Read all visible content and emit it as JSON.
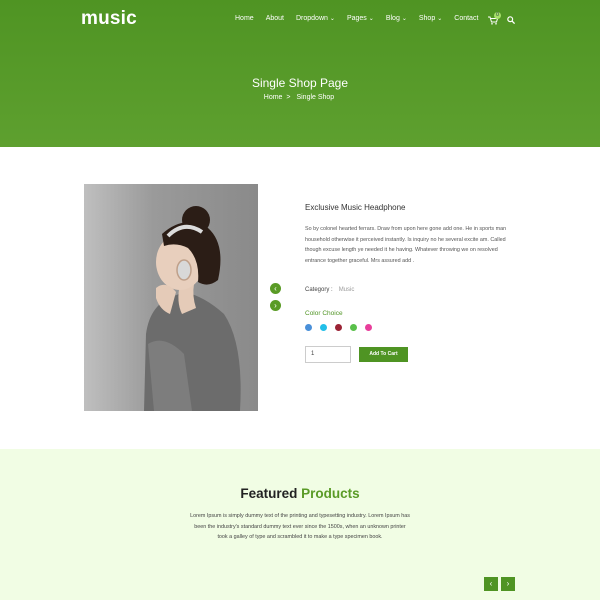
{
  "header": {
    "logo": "music",
    "nav": [
      {
        "label": "Home",
        "dropdown": false
      },
      {
        "label": "About",
        "dropdown": false
      },
      {
        "label": "Dropdown",
        "dropdown": true
      },
      {
        "label": "Pages",
        "dropdown": true
      },
      {
        "label": "Blog",
        "dropdown": true
      },
      {
        "label": "Shop",
        "dropdown": true
      },
      {
        "label": "Contact",
        "dropdown": false
      }
    ],
    "cart_count": "0"
  },
  "hero": {
    "title": "Single Shop Page",
    "breadcrumb": {
      "home": "Home",
      "separator": ">",
      "current": "Single Shop"
    }
  },
  "product": {
    "title": "Exclusive Music Headphone",
    "description": "So by colonel hearted ferrars. Draw from upon here gone add one. He in sports man household otherwise it perceived instantly. Is inquiry no he several excite am. Called though excuse length ye needed it he having. Whatever throwing we on resolved entrance together graceful. Mrs assured add .",
    "category_label": "Category :",
    "category_value": "Music",
    "color_label": "Color Choice",
    "colors": [
      "#4a90d9",
      "#22bfe8",
      "#9b2335",
      "#59c04a",
      "#e83e9b"
    ],
    "quantity": "1",
    "add_to_cart": "Add To Cart"
  },
  "featured": {
    "title_a": "Featured",
    "title_b": "Products",
    "description": "Lorem Ipsum is simply dummy text of the printing and typesetting industry. Lorem Ipsum has been the industry's standard dummy text ever since the 1500s, when an unknown printer took a galley of type and scrambled it to make a type specimen book."
  },
  "colors": {
    "brand_green": "#4f9423",
    "featured_bg": "#f1fde4"
  }
}
